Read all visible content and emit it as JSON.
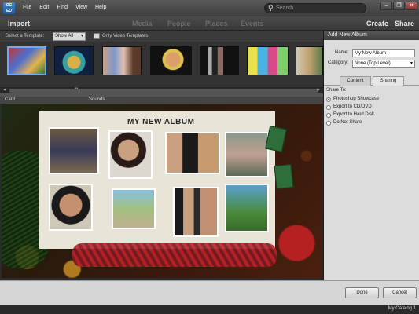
{
  "app": {
    "icon_text": "OG ED"
  },
  "menu": [
    "File",
    "Edit",
    "Find",
    "View",
    "Help"
  ],
  "search": {
    "placeholder": "Search"
  },
  "window_controls": [
    "–",
    "❐",
    "✕"
  ],
  "modes": {
    "import": "Import",
    "media": "Media",
    "people": "People",
    "places": "Places",
    "events": "Events",
    "create": "Create",
    "share": "Share"
  },
  "template_bar": {
    "select_label": "Select a Template:",
    "select_value": "Show All",
    "video_only_label": "Only Video Templates"
  },
  "editor": {
    "tab_card": "Card",
    "tab_sounds": "Sounds",
    "album_title": "MY NEW ALBUM"
  },
  "panel": {
    "title": "Add New Album",
    "name_label": "Name:",
    "name_value": "My New Album",
    "category_label": "Category:",
    "category_value": "None (Top Level)",
    "tabs": [
      "Content",
      "Sharing"
    ],
    "active_tab": "Sharing",
    "share_to_label": "Share To:",
    "options": [
      "Photoshop Showcase",
      "Export to CD/DVD",
      "Export to Hard Disk",
      "Do Not Share"
    ],
    "selected_option": "Photoshop Showcase"
  },
  "buttons": {
    "done": "Done",
    "cancel": "Cancel"
  },
  "status": {
    "catalog": "My Catalog 1"
  }
}
